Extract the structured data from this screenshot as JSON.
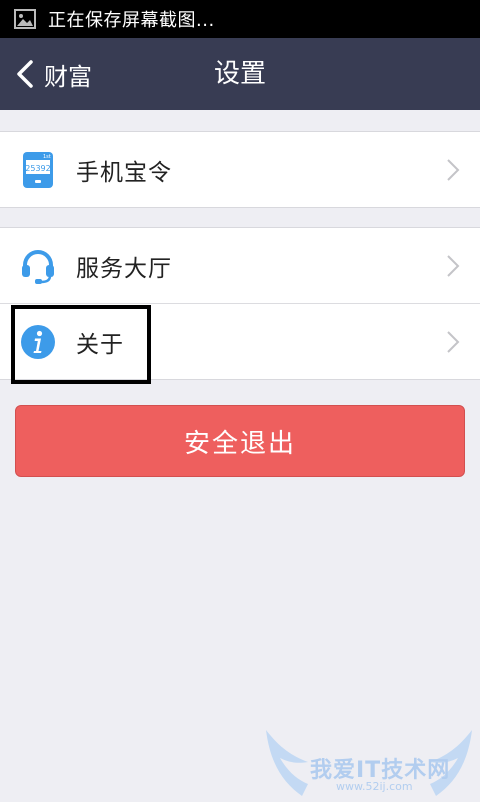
{
  "status_bar": {
    "notification_text": "正在保存屏幕截图..."
  },
  "nav": {
    "back_label": "财富",
    "title": "设置"
  },
  "settings": {
    "rows": [
      {
        "label": "手机宝令",
        "icon": "token-device-icon",
        "token_code": "25392",
        "token_tag": "1st"
      },
      {
        "label": "服务大厅",
        "icon": "headset-icon"
      },
      {
        "label": "关于",
        "icon": "info-icon"
      }
    ]
  },
  "logout_label": "安全退出",
  "watermark": {
    "text": "我爱IT技术网",
    "url": "www.52ij.com"
  },
  "colors": {
    "status_bar": "#000000",
    "nav_bar": "#383c53",
    "background": "#eeeef3",
    "accent_blue": "#3d9be9",
    "logout_red": "#ee5f5e"
  }
}
